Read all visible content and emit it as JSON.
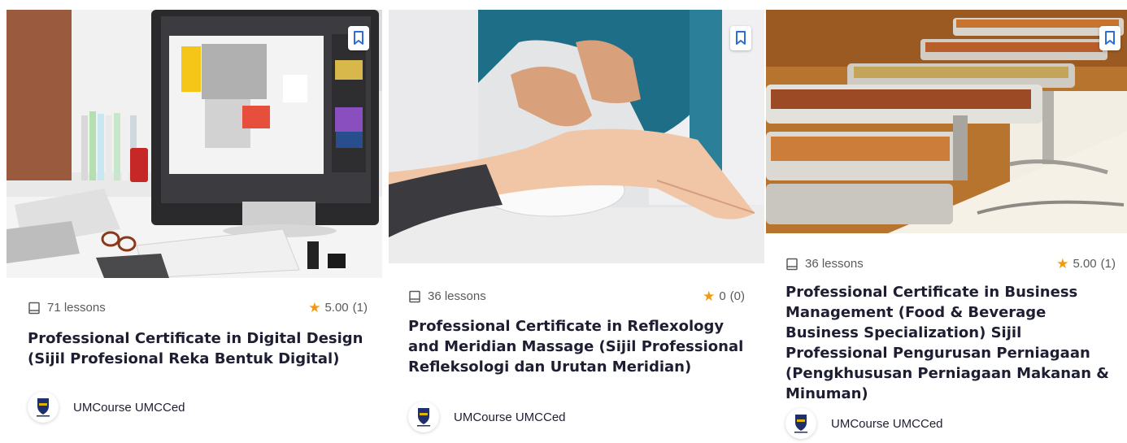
{
  "courses": [
    {
      "lessons": "71 lessons",
      "rating": "5.00",
      "rating_count": "(1)",
      "title": "Professional Certificate in Digital Design (Sijil Profesional Reka Bentuk Digital)",
      "author": "UMCourse UMCCed"
    },
    {
      "lessons": "36 lessons",
      "rating": "0",
      "rating_count": "(0)",
      "title": "Professional Certificate in Reflexology and Meridian Massage (Sijil Professional Refleksologi dan Urutan Meridian)",
      "author": "UMCourse UMCCed"
    },
    {
      "lessons": "36 lessons",
      "rating": "5.00",
      "rating_count": "(1)",
      "title": "Professional Certificate in Business Management (Food & Beverage Business Specialization) Sijil Professional Pengurusan Perniagaan (Pengkhususan Perniagaan Makanan & Minuman)",
      "author": "UMCourse UMCCed"
    }
  ],
  "icons": {
    "bookmark": "bookmark-icon",
    "lessons": "book-icon",
    "rating": "star-icon",
    "avatar": "university-crest-icon"
  },
  "colors": {
    "accent": "#2b6fd6",
    "star": "#f29a0f",
    "title": "#1e1e32",
    "meta": "#5a5a5a"
  }
}
